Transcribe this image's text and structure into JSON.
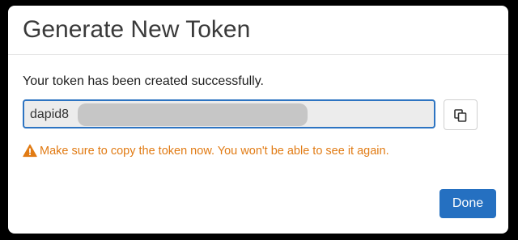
{
  "dialog": {
    "title": "Generate New Token",
    "success_message": "Your token has been created successfully.",
    "token_visible_prefix": "dapid8",
    "token_rest_redacted": true,
    "warning": "Make sure to copy the token now. You won't be able to see it again.",
    "done_label": "Done"
  },
  "icons": {
    "warning": "warning-triangle-icon",
    "copy": "copy-icon"
  },
  "colors": {
    "primary": "#2570c1",
    "focus_border": "#2d74c2",
    "warning": "#e17b14",
    "field_background": "#ececec",
    "redaction": "#c6c6c6"
  }
}
